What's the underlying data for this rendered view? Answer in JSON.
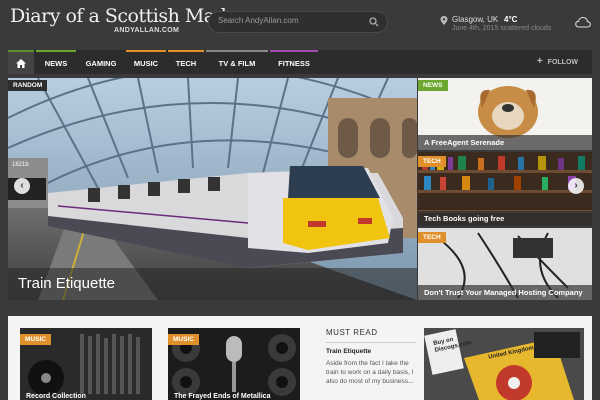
{
  "header": {
    "logo_title": "Diary of a Scottish Madman",
    "logo_subtitle": "ANDYALLAN.COM",
    "search_placeholder": "Search AndyAllan.com",
    "weather": {
      "location": "Glasgow, UK",
      "temperature": "4°C",
      "date_line": "June 4th, 2015 scattered clouds"
    }
  },
  "nav": {
    "items": [
      {
        "label": "NEWS",
        "accent": "#6ca72f"
      },
      {
        "label": "GAMING",
        "accent": "#2c2c2c"
      },
      {
        "label": "MUSIC",
        "accent": "#e0902b"
      },
      {
        "label": "TECH",
        "accent": "#e0902b"
      },
      {
        "label": "TV & FILM",
        "accent": "#888888"
      },
      {
        "label": "FITNESS",
        "accent": "#a04cb0"
      }
    ],
    "follow_label": "FOLLOW"
  },
  "hero": {
    "tag": "RANDOM",
    "title": "Train Etiquette",
    "clock_text": "1821b"
  },
  "side_posts": [
    {
      "tag": "NEWS",
      "title": "A FreeAgent Serenade"
    },
    {
      "tag": "TECH",
      "title": "Tech Books going free"
    },
    {
      "tag": "TECH",
      "title": "Don't Trust Your Managed Hosting Company"
    }
  ],
  "lower": {
    "cards": [
      {
        "tag": "MUSIC",
        "title": "Record Collection"
      },
      {
        "tag": "MUSIC",
        "title": "The Frayed Ends of Metallica"
      }
    ],
    "must_read": {
      "heading": "MUST READ",
      "title": "Train Etiquette",
      "excerpt": "Aside from the fact I take the train to work on a daily basis, I also do most of my business..."
    },
    "ad_text": "Buy on Discogs.com",
    "ad_label": "United Kingdom"
  },
  "colors": {
    "green": "#6ca72f",
    "orange": "#e0902b",
    "dark": "#2c2c2c"
  }
}
